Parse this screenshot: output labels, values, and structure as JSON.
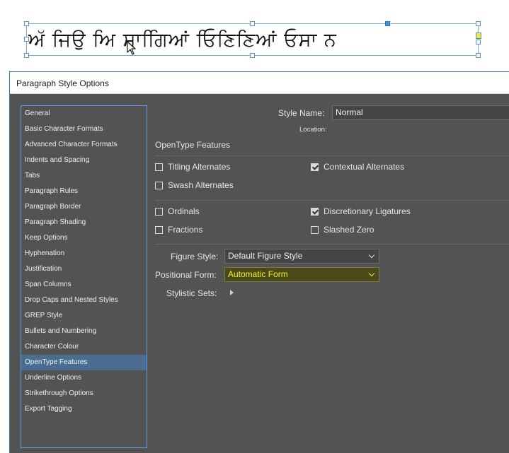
{
  "canvas": {
    "sample_text": "ਅੱ ਜਿਉ ਅਿ ਸਾਗਿਿਆਂ ਓਿਣਿਣਿਆਂ ਓਸਾ ਨ"
  },
  "dialog": {
    "title": "Paragraph Style Options",
    "sidebar": {
      "selected_index": 16,
      "items": [
        "General",
        "Basic Character Formats",
        "Advanced Character Formats",
        "Indents and Spacing",
        "Tabs",
        "Paragraph Rules",
        "Paragraph Border",
        "Paragraph Shading",
        "Keep Options",
        "Hyphenation",
        "Justification",
        "Span Columns",
        "Drop Caps and Nested Styles",
        "GREP Style",
        "Bullets and Numbering",
        "Character Colour",
        "OpenType Features",
        "Underline Options",
        "Strikethrough Options",
        "Export Tagging"
      ]
    },
    "style_name_label": "Style Name:",
    "style_name_value": "Normal",
    "location_label": "Location:",
    "section_title": "OpenType Features",
    "checkboxes": {
      "titling_alternates": {
        "label": "Titling Alternates",
        "checked": false
      },
      "contextual_alternates": {
        "label": "Contextual Alternates",
        "checked": true
      },
      "swash_alternates": {
        "label": "Swash Alternates",
        "checked": false
      },
      "ordinals": {
        "label": "Ordinals",
        "checked": false
      },
      "discretionary_ligatures": {
        "label": "Discretionary Ligatures",
        "checked": true
      },
      "fractions": {
        "label": "Fractions",
        "checked": false
      },
      "slashed_zero": {
        "label": "Slashed Zero",
        "checked": false
      }
    },
    "figure_style_label": "Figure Style:",
    "figure_style_value": "Default Figure Style",
    "positional_form_label": "Positional Form:",
    "positional_form_value": "Automatic Form",
    "stylistic_sets_label": "Stylistic Sets:",
    "colors": {
      "dialog_bg": "#535353",
      "selection_bg": "#4b6d91",
      "highlight_text": "#f6ee2a"
    }
  }
}
